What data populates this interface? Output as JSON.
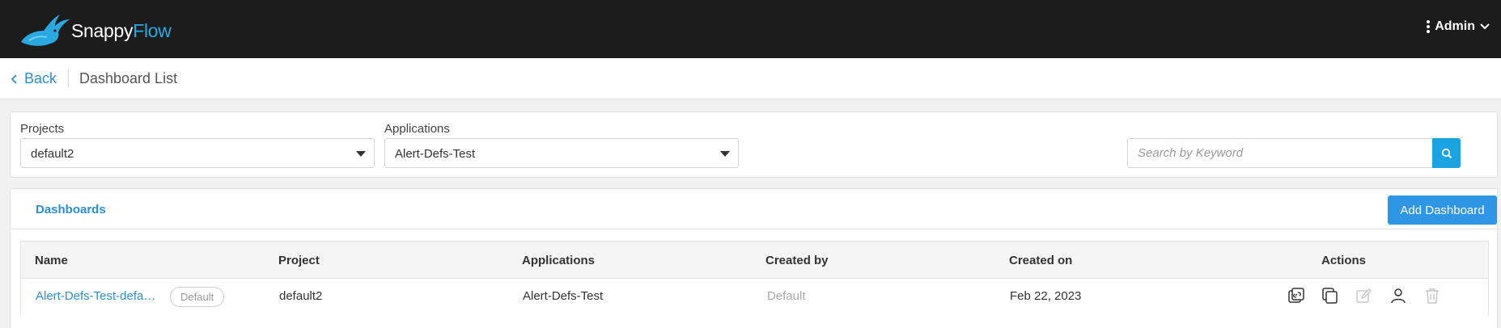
{
  "app": {
    "logo_part1": "Snappy",
    "logo_part2": "Flow",
    "user_menu_label": "Admin"
  },
  "breadcrumb": {
    "back_label": "Back",
    "title": "Dashboard List"
  },
  "filters": {
    "projects_label": "Projects",
    "projects_value": "default2",
    "applications_label": "Applications",
    "applications_value": "Alert-Defs-Test",
    "search_placeholder": "Search by Keyword",
    "search_value": ""
  },
  "dashboards": {
    "tab_label": "Dashboards",
    "add_button_label": "Add Dashboard",
    "columns": [
      "Name",
      "Project",
      "Applications",
      "Created by",
      "Created on",
      "Actions"
    ],
    "rows": [
      {
        "name": "Alert-Defs-Test-defa…",
        "badge": "Default",
        "project": "default2",
        "applications": "Alert-Defs-Test",
        "created_by": "Default",
        "created_on": "Feb 22, 2023",
        "actions": [
          "share-link-icon",
          "copy-icon",
          "edit-icon",
          "user-icon",
          "delete-icon"
        ]
      }
    ]
  },
  "colors": {
    "accent": "#2b8fd6",
    "topbar": "#1c1c1c",
    "search_button": "#1aa3e0",
    "add_button": "#2e96e5"
  }
}
